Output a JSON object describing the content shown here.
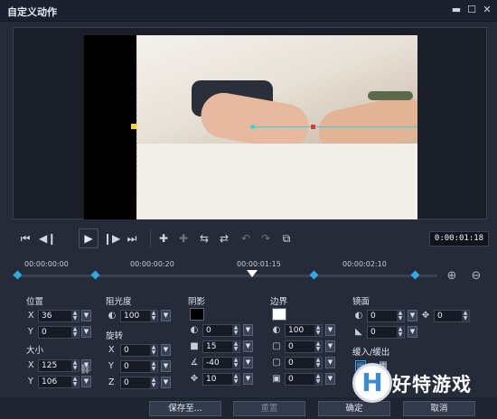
{
  "window": {
    "title": "自定义动作",
    "min": "▬",
    "max": "☐",
    "close": "✕"
  },
  "controls": {
    "timecode": "0:00:01:18"
  },
  "timeline": {
    "labels": [
      "00:00:00:00",
      "00:00:00:20",
      "00:00:01:15",
      "00:00:02:10"
    ]
  },
  "position": {
    "label": "位置",
    "x_label": "X",
    "x": "36",
    "y_label": "Y",
    "y": "0"
  },
  "size": {
    "label": "大小",
    "x_label": "X",
    "x": "125",
    "y_label": "Y",
    "y": "106"
  },
  "opacity": {
    "label": "阻光度",
    "value": "100"
  },
  "rotation": {
    "label": "旋转",
    "x_label": "X",
    "x": "0",
    "y_label": "Y",
    "y": "0",
    "z_label": "Z",
    "z": "0"
  },
  "shadow": {
    "label": "阴影",
    "color": "#000000",
    "opacity": "0",
    "blur": "15",
    "angle": "-40",
    "distance": "10"
  },
  "border": {
    "label": "边界",
    "color": "#ffffff",
    "opacity": "100",
    "width": "0",
    "radius": "0",
    "blur": "0"
  },
  "mirror": {
    "label": "镜面",
    "opacity": "0",
    "offset": "0",
    "fade": "0"
  },
  "fade_in_out": {
    "label": "缓入/缓出"
  },
  "buttons": {
    "save_as": "保存至...",
    "reset": "重置",
    "ok": "确定",
    "cancel": "取消"
  },
  "watermark": {
    "logo": "H",
    "text": "好特游戏"
  }
}
